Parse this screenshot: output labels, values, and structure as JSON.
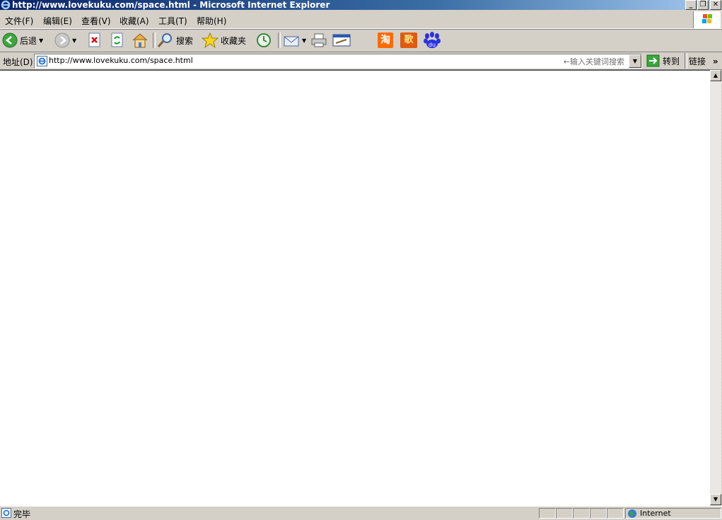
{
  "window": {
    "title": "http://www.lovekuku.com/space.html - Microsoft Internet Explorer",
    "minimize_glyph": "_",
    "restore_glyph": "❐",
    "close_glyph": "✕"
  },
  "menu": {
    "items": [
      "文件(F)",
      "编辑(E)",
      "查看(V)",
      "收藏(A)",
      "工具(T)",
      "帮助(H)"
    ]
  },
  "toolbar": {
    "back_label": "后退",
    "search_label": "搜索",
    "favorites_label": "收藏夹",
    "taobao_glyph": "淘",
    "music_glyph": "歌",
    "baidu_glyph": "du",
    "icons": [
      "back-icon",
      "forward-icon",
      "stop-icon",
      "refresh-icon",
      "home-icon",
      "search-icon",
      "favorites-icon",
      "history-icon",
      "mail-icon",
      "print-icon",
      "edit-icon",
      "taobao-icon",
      "music-icon",
      "baidu-icon"
    ]
  },
  "address": {
    "label": "地址(D)",
    "url": "http://www.lovekuku.com/space.html",
    "hint": "←输入关键词搜索",
    "go_label": "转到",
    "links_label": "链接",
    "links_more": "»"
  },
  "status": {
    "text": "完毕",
    "zone": "Internet"
  },
  "colors": {
    "title_start": "#0a246a",
    "title_end": "#a6caf0",
    "chrome": "#d4d0c8"
  }
}
